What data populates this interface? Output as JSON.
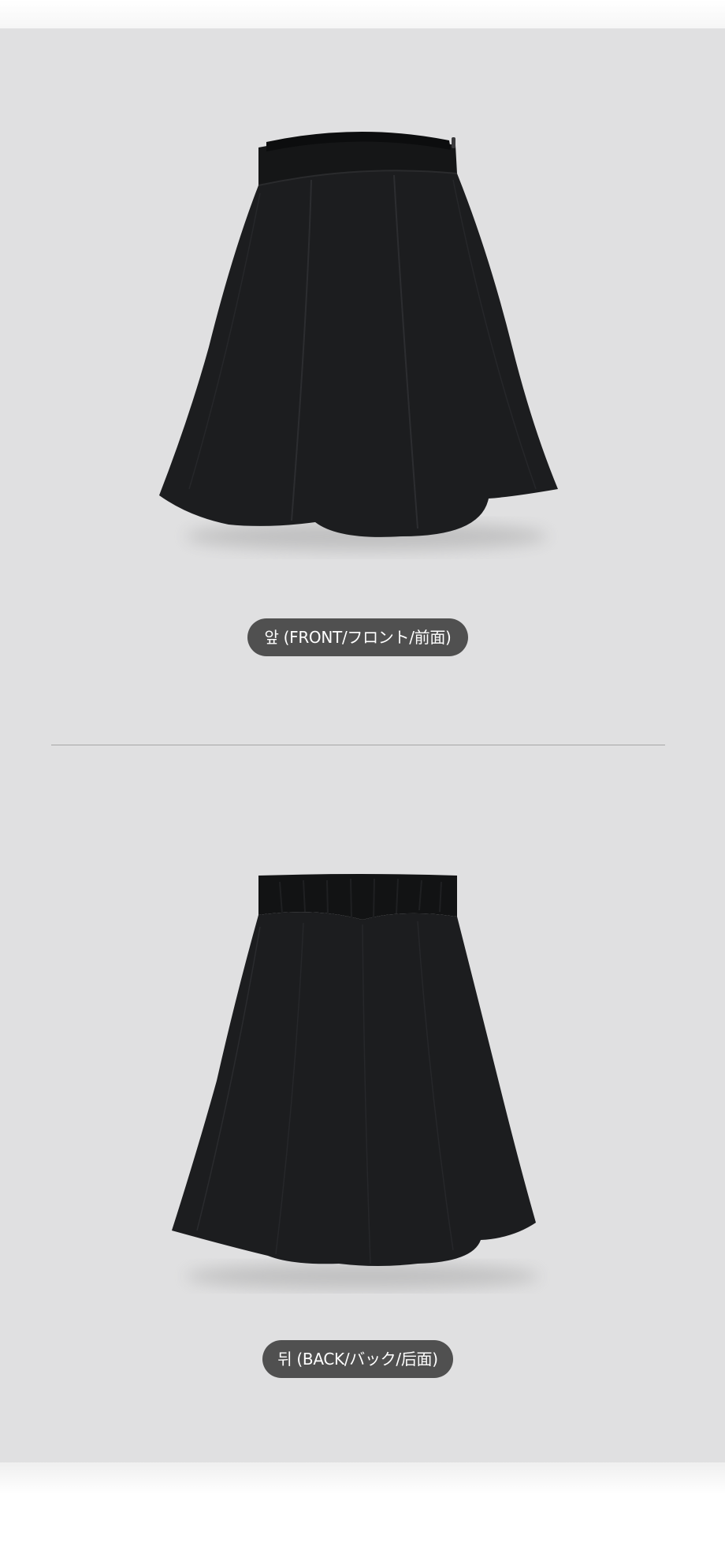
{
  "sections": {
    "front": {
      "label": "앞 (FRONT/フロント/前面)",
      "image_subject": "black flared skirt front view"
    },
    "back": {
      "label": "뒤 (BACK/バック/后面)",
      "image_subject": "black flared skirt back view"
    }
  },
  "colors": {
    "panel_background": "#e0e0e1",
    "label_background": "#505050",
    "label_text": "#ffffff",
    "skirt": "#1c1d1f",
    "divider": "#a6a6a6"
  }
}
